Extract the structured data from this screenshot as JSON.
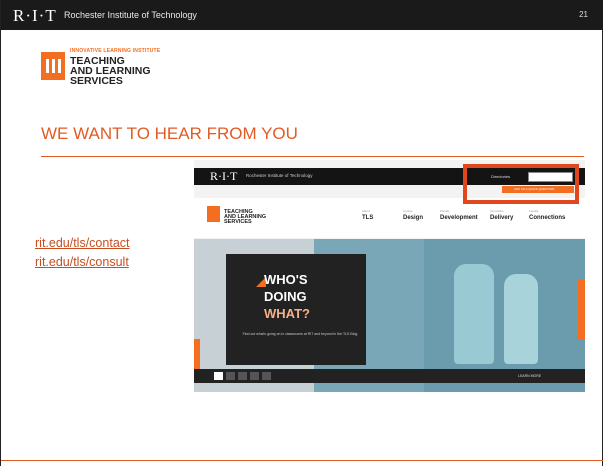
{
  "header": {
    "logo": "R·I·T",
    "institution": "Rochester Institute of Technology",
    "page_number": "21"
  },
  "tls_logo": {
    "institute": "INNOVATIVE LEARNING INSTITUTE",
    "line1": "TEACHING",
    "line2": "AND LEARNING",
    "line3": "SERVICES"
  },
  "title": "WE WANT TO HEAR FROM YOU",
  "links": [
    "rit.edu/tls/contact",
    "rit.edu/tls/consult"
  ],
  "website_screenshot": {
    "logo": "R·I·T",
    "institution": "Rochester Institute of Technology",
    "directory_label": "Directories",
    "search_placeholder": "Search this site",
    "orange_button": "ASK US A QUICK QUESTION",
    "tls_line1": "TEACHING",
    "tls_line2": "AND LEARNING",
    "tls_line3": "SERVICES",
    "nav": [
      {
        "sub": "About",
        "label": "TLS"
      },
      {
        "sub": "Course",
        "label": "Design"
      },
      {
        "sub": "Faculty",
        "label": "Development"
      },
      {
        "sub": "Innovative",
        "label": "Delivery"
      },
      {
        "sub": "Faculty",
        "label": "Connections"
      }
    ],
    "hero_line1": "WHO'S",
    "hero_line2": "DOING",
    "hero_line3": "WHAT?",
    "hero_caption": "Find out what's going on in classrooms at RIT and beyond in the TLS Blog",
    "learn_more": "LEARN MORE",
    "colors": {
      "accent": "#f36e21",
      "highlight": "#e1461c"
    }
  },
  "colors": {
    "title": "#e25b25",
    "link": "#c84e1f",
    "topbar": "#1a1a1a"
  }
}
